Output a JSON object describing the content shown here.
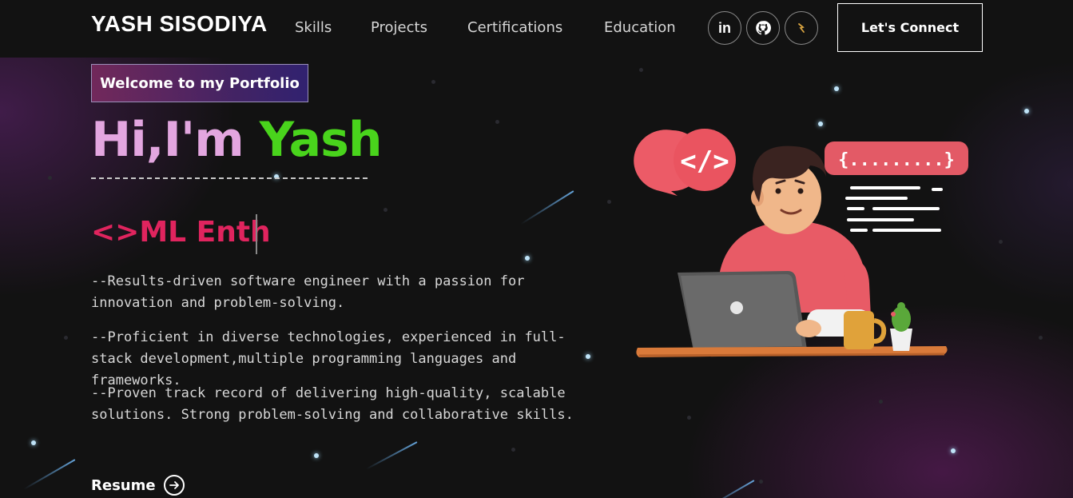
{
  "navbar": {
    "brand": "YASH SISODIYA",
    "links": [
      "Skills",
      "Projects",
      "Certifications",
      "Education"
    ],
    "social_icons": [
      "linkedin-icon",
      "github-icon",
      "codechef-icon"
    ],
    "cta_label": "Let's Connect"
  },
  "hero": {
    "tagline": "Welcome to my Portfolio",
    "greeting_prefix": "Hi,I'm ",
    "greeting_name": "Yash",
    "typing_text": "<>ML Enth",
    "paragraphs": [
      "--Results-driven software engineer with a passion for innovation and problem-solving.",
      "--Proficient in diverse technologies, experienced in full-stack development,multiple programming languages and frameworks.",
      "--Proven track record of delivering high-quality, scalable solutions. Strong problem-solving and collaborative skills."
    ],
    "resume_label": "Resume",
    "illustration_code_bubble": "</>",
    "illustration_braces": "{.........}"
  },
  "colors": {
    "greeting_hi": "#e3a6e0",
    "greeting_name": "#49d41c",
    "typing": "#e0245e",
    "tagline_gradient_start": "#aa367c",
    "tagline_gradient_end": "#4a2fbd"
  }
}
